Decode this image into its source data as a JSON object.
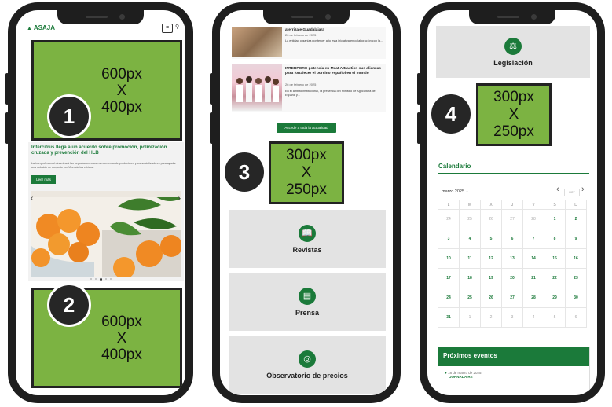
{
  "ad_unit": {
    "line1": "600px",
    "line2": "X",
    "line3": "400px"
  },
  "ad_unit_small": {
    "line1": "300px",
    "line2": "X",
    "line3": "250px"
  },
  "badges": [
    "1",
    "2",
    "3",
    "4"
  ],
  "phone1": {
    "logo": "ASAJA",
    "hero_title": "Intercitrus llega a un acuerdo sobre promoción, polinización cruzada y prevención del HLB",
    "hero_summary": "La interprofesional dinamizará las negociaciones con un consenso de productores y comercializadores para ayudar una solución de conjunto por Vivencia los cítricos.",
    "read_more": "Leer más",
    "prev_arrow": "‹",
    "next_arrow": "›"
  },
  "phone2": {
    "news": [
      {
        "title": "aterrizaje Guadalajara",
        "date": "20 de febrero de 2025",
        "excerpt": "La entidad organiza por tercer año esta iniciativa en colaboración con la..."
      },
      {
        "title": "INTERPORC potencia en Meat Attraction sus alianzas para fortalecer el porcino español en el mundo",
        "date": "26 de febrero de 2025",
        "excerpt": "En el ámbito institucional, la presencia del ministro de Agricultura de España y..."
      }
    ],
    "all_news_button": "Accede a toda la actualidad",
    "cards": [
      {
        "icon": "📖",
        "label": "Revistas"
      },
      {
        "icon": "▤",
        "label": "Prensa"
      },
      {
        "icon": "◎",
        "label": "Observatorio de precios"
      }
    ]
  },
  "phone3": {
    "legislation_label": "Legislación",
    "legislation_icon": "⚖",
    "calendar_title": "Calendario",
    "month": "marzo 2025",
    "month_caret": "⌄",
    "prev": "‹",
    "today": "HOY",
    "next": "›",
    "weekdays": [
      "L",
      "M",
      "X",
      "J",
      "V",
      "S",
      "D"
    ],
    "weeks": [
      [
        "24",
        "25",
        "26",
        "27",
        "28",
        "1",
        "2"
      ],
      [
        "3",
        "4",
        "5",
        "6",
        "7",
        "8",
        "9"
      ],
      [
        "10",
        "11",
        "12",
        "13",
        "14",
        "15",
        "16"
      ],
      [
        "17",
        "18",
        "19",
        "20",
        "21",
        "22",
        "23"
      ],
      [
        "24",
        "25",
        "26",
        "27",
        "28",
        "29",
        "30"
      ],
      [
        "31",
        "1",
        "2",
        "3",
        "4",
        "5",
        "6"
      ]
    ],
    "events_title": "Próximos eventos",
    "event_date": "18 de marzo de 2025",
    "event_name": "JORNADA RE"
  }
}
